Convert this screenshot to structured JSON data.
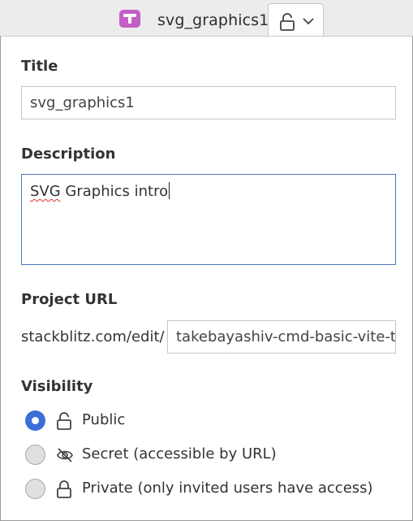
{
  "header": {
    "logo_icon": "stackblitz-t-icon",
    "project_name": "svg_graphics1",
    "lock_icon": "unlock-icon",
    "chevron_icon": "chevron-down-icon"
  },
  "form": {
    "title": {
      "label": "Title",
      "value": "svg_graphics1"
    },
    "description": {
      "label": "Description",
      "misspelled_word": "SVG",
      "rest": " Graphics intro"
    },
    "project_url": {
      "label": "Project URL",
      "prefix": "stackblitz.com/edit/",
      "value": "takebayashiv-cmd-basic-vite-te"
    },
    "visibility": {
      "label": "Visibility",
      "selected": "public",
      "options": [
        {
          "id": "public",
          "label": "Public",
          "icon": "unlock-icon"
        },
        {
          "id": "secret",
          "label": "Secret (accessible by URL)",
          "icon": "eye-off-icon"
        },
        {
          "id": "private",
          "label": "Private (only invited users have access)",
          "icon": "lock-icon"
        }
      ]
    }
  },
  "colors": {
    "accent": "#3a6fd8",
    "logo": "#c45ec4",
    "focus_border": "#4a78b8"
  }
}
